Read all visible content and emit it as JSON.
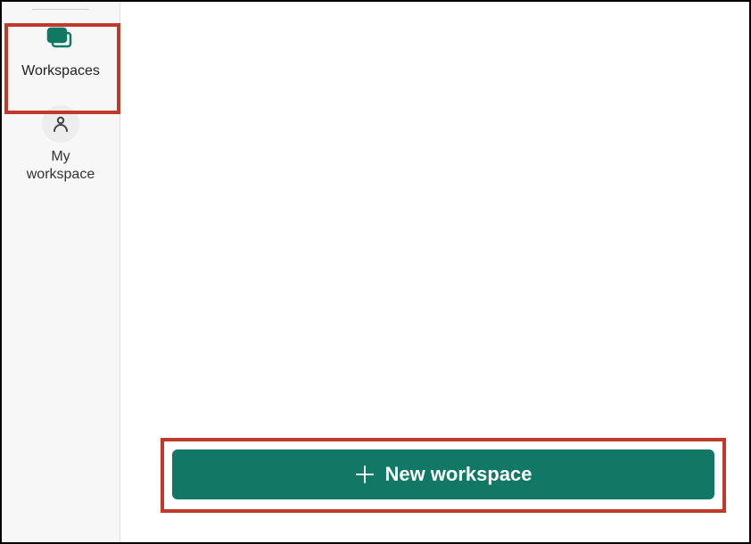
{
  "colors": {
    "accent": "#117865",
    "highlight": "#c0392b"
  },
  "sidebar": {
    "items": [
      {
        "label": "Workspaces"
      },
      {
        "label": "My\nworkspace"
      }
    ]
  },
  "buttons": {
    "new_workspace": "New workspace"
  }
}
